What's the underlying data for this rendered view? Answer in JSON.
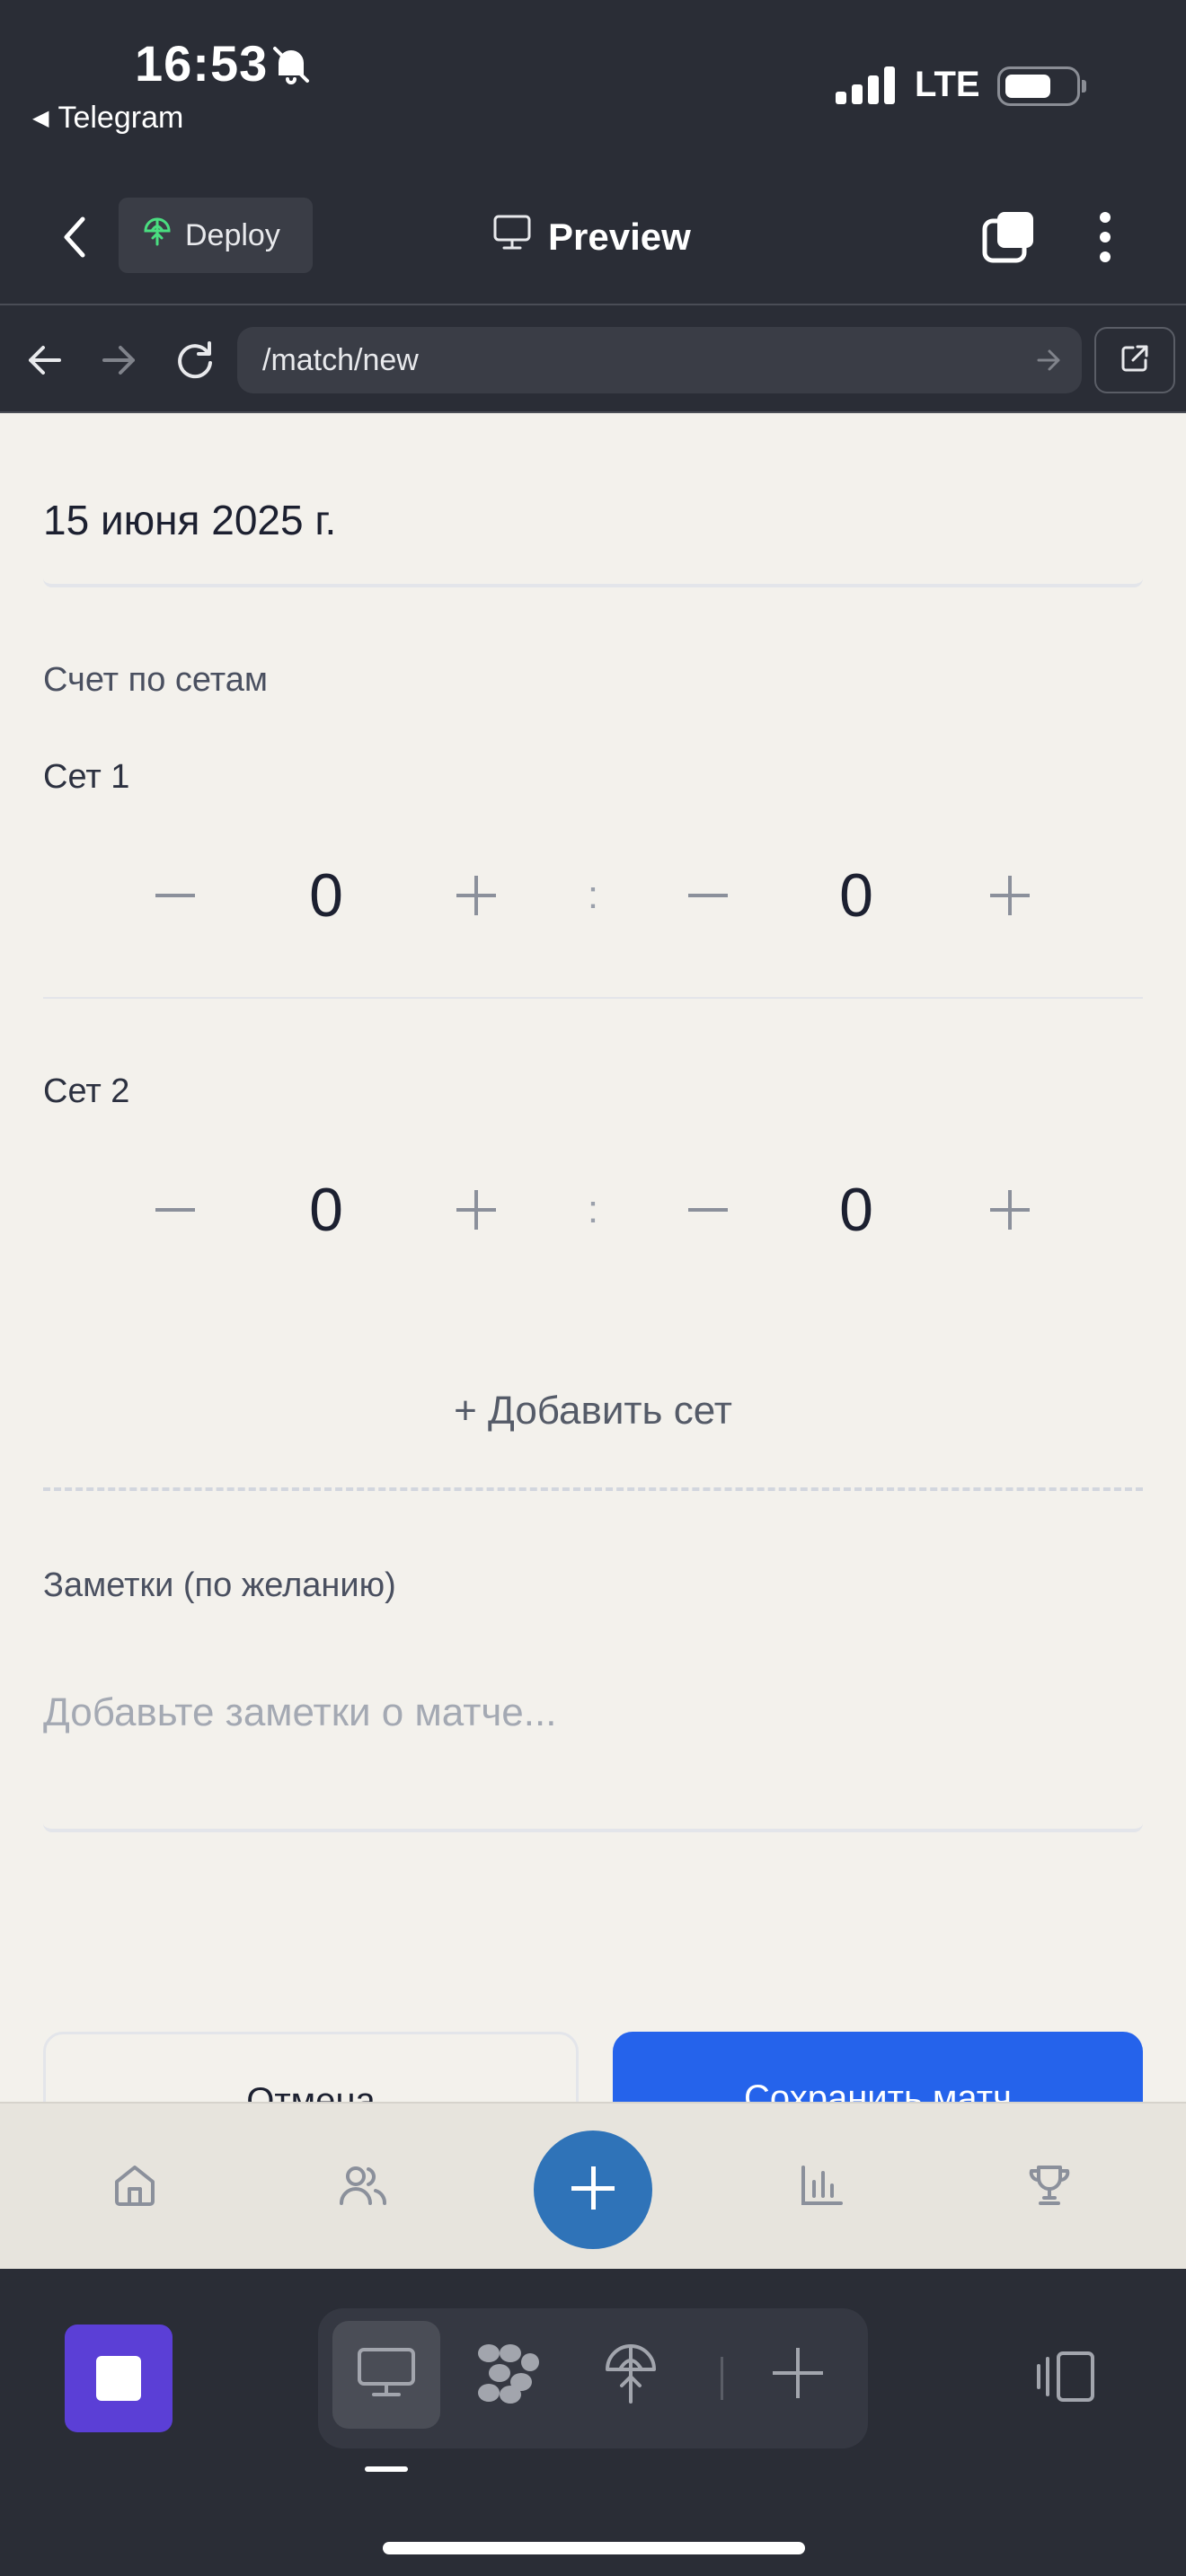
{
  "status_bar": {
    "time": "16:53",
    "back_app": "Telegram",
    "network": "LTE"
  },
  "app_bar": {
    "deploy_label": "Deploy",
    "preview_label": "Preview"
  },
  "url_bar": {
    "url": "/match/new"
  },
  "form": {
    "date": "15 июня 2025 г.",
    "sets_title": "Счет по сетам",
    "sets": [
      {
        "label": "Сет 1",
        "score_a": "0",
        "score_b": "0"
      },
      {
        "label": "Сет 2",
        "score_a": "0",
        "score_b": "0"
      }
    ],
    "separator": ":",
    "add_set": "+ Добавить сет",
    "notes_label": "Заметки (по желанию)",
    "notes_placeholder": "Добавьте заметки о матче...",
    "cancel": "Отмена",
    "save": "Сохранить матч"
  },
  "bottom_nav": {
    "items": [
      "home-icon",
      "users-icon",
      "plus-icon",
      "chart-icon",
      "trophy-icon"
    ],
    "fab_color": "#2f73b8"
  },
  "ide_toolbar": {
    "tools": [
      "desktop-icon",
      "grid-blob-icon",
      "deploy-icon",
      "plus-icon"
    ],
    "stop_color": "#5b3fd6"
  },
  "colors": {
    "primary": "#2563eb",
    "page_bg": "#f3f1ec",
    "chrome_bg": "#2a2d36"
  }
}
